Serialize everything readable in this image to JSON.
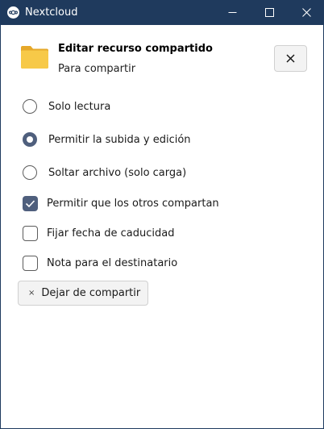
{
  "window": {
    "title": "Nextcloud",
    "controls": [
      "minimize",
      "maximize",
      "close"
    ]
  },
  "header": {
    "icon": "folder-icon",
    "title": "Editar recurso compartido",
    "subtitle": "Para compartir",
    "close_label": "✕"
  },
  "permissions": {
    "options": [
      {
        "label": "Solo lectura",
        "selected": false
      },
      {
        "label": "Permitir la subida y edición",
        "selected": true
      },
      {
        "label": "Soltar archivo (solo carga)",
        "selected": false
      }
    ]
  },
  "settings": {
    "checkboxes": [
      {
        "label": "Permitir que los otros compartan",
        "checked": true
      },
      {
        "label": "Fijar fecha de caducidad",
        "checked": false
      },
      {
        "label": "Nota para el destinatario",
        "checked": false
      }
    ]
  },
  "unshare": {
    "icon_label": "×",
    "label": "Dejar de compartir"
  },
  "colors": {
    "titlebar": "#1f3a5d",
    "accent": "#4f5f7d",
    "folder": "#f7c948"
  }
}
